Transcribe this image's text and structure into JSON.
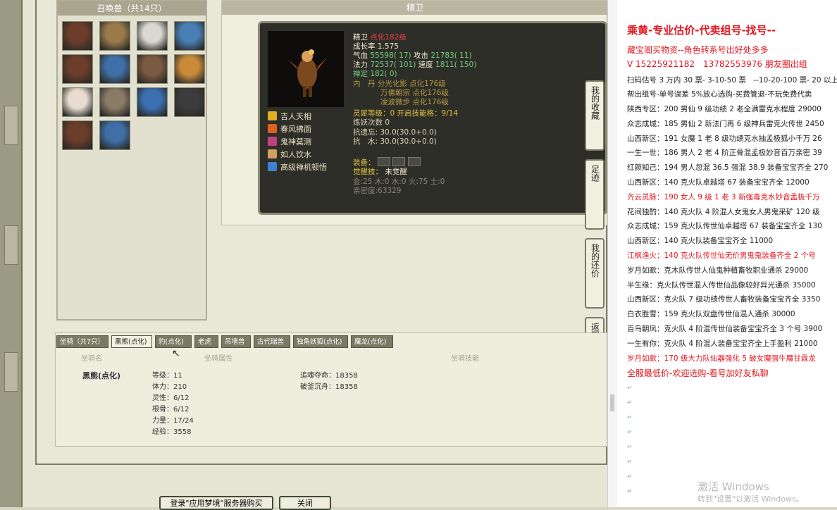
{
  "pets": {
    "title": "召唤兽（共14只）",
    "colors": [
      "#6b3d2a",
      "#9a7a4a",
      "#d8d8d0",
      "#4a7fb5",
      "#6b3d2a",
      "#3f6fa6",
      "#7a5a40",
      "#c98a3a",
      "#e8dcd0",
      "#8a7a66",
      "#3a6fb0",
      "#3c3c3c",
      "#6b3d2a",
      "#3f6fa6"
    ]
  },
  "detail": {
    "title": "精卫",
    "name": "精卫",
    "level": "点化182级",
    "growth": "成长率 1.575",
    "hp_label": "气血",
    "hp": "55598( 17)",
    "atk_label": "攻击",
    "atk": "21783( 11)",
    "mp_label": "法力",
    "mp": "72537( 101)",
    "spd_label": "速度",
    "spd": "1811( 150)",
    "stable": "禅定 182( 0)",
    "neidan": "内　丹",
    "nd1": "分光化影 点化176级",
    "nd2": "万佛朝宗 点化176级",
    "nd3": "凌波微步 点化176级",
    "lingxi": "灵犀等级：0 开启技能格：9/14",
    "lianyao": "炼妖次数 0",
    "resist1": "抗遗忘: 30.0(30.0+0.0)",
    "resist2": "抗　水: 30.0(30.0+0.0)",
    "equip": "装备：",
    "awaken": "觉醒技：",
    "awaken_val": "未觉醒",
    "elements": "金:25 木:0 水:0 火:75 土:0",
    "intimacy": "亲密度:63329",
    "skills": [
      {
        "label": "吉人天相",
        "color": "#e0b020"
      },
      {
        "label": "春风拂面",
        "color": "#e06020"
      },
      {
        "label": "鬼神莫测",
        "color": "#c04080"
      },
      {
        "label": "如人饮水",
        "color": "#d0a060"
      },
      {
        "label": "高级禅机顿悟",
        "color": "#4080d0"
      }
    ]
  },
  "side_tabs": [
    "我的收藏",
    "足迹",
    "我的还价",
    "返回顶部"
  ],
  "mounts": {
    "title": "坐骑（共7只）",
    "tabs": [
      "黑熊(点化)",
      "豹(点化)",
      "老虎",
      "吊墙兽",
      "古代瑞兽",
      "独角妖狐(点化)",
      "魔龙(点化)"
    ],
    "hdr_name": "坐骑名",
    "hdr_attr": "坐骑属性",
    "hdr_skill": "坐骑技能",
    "name": "黑熊(点化)",
    "attrs": [
      "等级：11",
      "体力：210",
      "灵性：6/12",
      "根骨：6/12",
      "力量：17/24",
      "经验：3558"
    ],
    "skills": [
      "追魂夺命：18358",
      "破釜沉舟：18358"
    ]
  },
  "buttons": {
    "btn1": "登录\"应用梦境\"服务器购买",
    "btn2": "关闭"
  },
  "doc": {
    "title": "乘黄-专业估价-代卖组号-找号--",
    "line1": "藏宝阁买物资--角色转系号出好处多多",
    "line2": "V 15225921182　13782553976 朋友圈出组",
    "line3": "扫码估号 3 万内 30 票- 3-10-50 票　--10-20-100 票- 20 以上",
    "line4": "帮出组号-单号误差 5%放心选购-买费管退-不玩免费代卖",
    "entries": [
      {
        "t": "陕西专区：200 男仙 9 级功绩 2 老全满雷克水程度 29000",
        "red": false
      },
      {
        "t": "众志成城：185 男仙 2 新法门再 6 级神兵雷克火传世 2450",
        "red": false
      },
      {
        "t": "山西新区：191 女魔 1 老 8 级功绩克水抽孟极狐小千万 26",
        "red": false
      },
      {
        "t": "一生一世：186 男人 2 老 4 阶正骨混孟极妙音百万亲密 39",
        "red": false
      },
      {
        "t": "红颜知己：194 男人忽混 36.5 强混 38.9 装备宝宝齐全 270",
        "red": false
      },
      {
        "t": "山西新区：140 克火队卓越塔 67 装备宝宝齐全 12000",
        "red": false
      },
      {
        "t": "齐云灵脉：190 女人 9 级 1 老 3 新强毒克水妙音孟极千万",
        "red": true
      },
      {
        "t": "花间独酌：140 克火队 4 阶混人女鬼女人男鬼采矿 120 级",
        "red": false
      },
      {
        "t": "众志成城：159 克火队传世仙卓越塔 67 装备宝宝齐全 130",
        "red": false
      },
      {
        "t": "山西新区：140 克火队装备宝宝齐全 11000",
        "red": false
      },
      {
        "t": "江枫渔火：140 克火队传世仙无价男鬼鬼装备齐全 2 个号",
        "red": true
      },
      {
        "t": "岁月如歌：克木队传世人仙鬼种植畜牧职业通杀 29000",
        "red": false
      },
      {
        "t": "半生缘：克火队传世混人传世仙品像较好异光通杀 35000",
        "red": false
      },
      {
        "t": "山西新区：克火队 7 级功绩传世人畜牧装备宝宝齐全 3350",
        "red": false
      },
      {
        "t": "白衣胜雪：159 克火队双盘传世仙混人通杀 30000",
        "red": false
      },
      {
        "t": "百鸟朝凤：克火队 4 阶混传世仙装备宝宝齐全 3 个号 3900",
        "red": false
      },
      {
        "t": "一生有你：克火队 4 阶混人装备宝宝齐全上手盈利 21000",
        "red": false
      },
      {
        "t": "岁月如歌：170 级大力队仙器强化 5 破女魔强牛魔甘霖龙",
        "red": true
      }
    ],
    "footer": "全服最低价-欢迎选购-看号加好友私聊",
    "watermark_title": "激活 Windows",
    "watermark_sub": "转到\"设置\"以激活 Windows。"
  }
}
